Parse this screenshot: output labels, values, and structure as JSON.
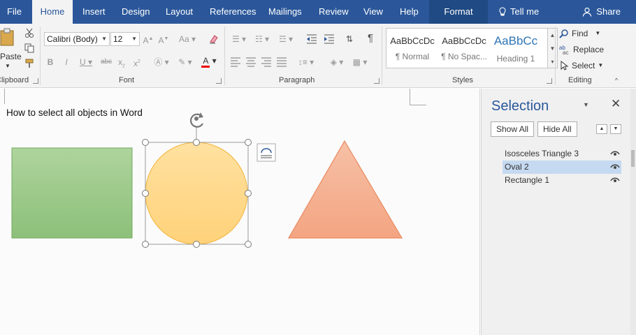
{
  "tabs": {
    "file": "File",
    "home": "Home",
    "insert": "Insert",
    "design": "Design",
    "layout": "Layout",
    "references": "References",
    "mailings": "Mailings",
    "review": "Review",
    "view": "View",
    "help": "Help",
    "format": "Format",
    "tell_me": "Tell me",
    "share": "Share"
  },
  "clipboard": {
    "paste": "Paste",
    "label": "Clipboard"
  },
  "font": {
    "name": "Calibri (Body)",
    "size": "12",
    "label": "Font"
  },
  "paragraph": {
    "label": "Paragraph"
  },
  "styles": {
    "label": "Styles",
    "items": [
      {
        "sample": "AaBbCcDc",
        "name": "¶ Normal"
      },
      {
        "sample": "AaBbCcDc",
        "name": "¶ No Spac..."
      },
      {
        "sample": "AaBbCc",
        "name": "Heading 1"
      }
    ]
  },
  "editing": {
    "find": "Find",
    "replace": "Replace",
    "select": "Select",
    "label": "Editing"
  },
  "document": {
    "text": "How to select all objects in Word"
  },
  "selection_pane": {
    "title": "Selection",
    "show_all": "Show All",
    "hide_all": "Hide All",
    "items": [
      {
        "label": "Isosceles Triangle 3",
        "selected": false
      },
      {
        "label": "Oval 2",
        "selected": true
      },
      {
        "label": "Rectangle 1",
        "selected": false
      }
    ]
  },
  "colors": {
    "tabbar": "#2b579a",
    "rectangle": "#92c47d",
    "oval": "#ffd98a",
    "triangle": "#f4a98a",
    "selected_row": "#c5d9f1"
  }
}
